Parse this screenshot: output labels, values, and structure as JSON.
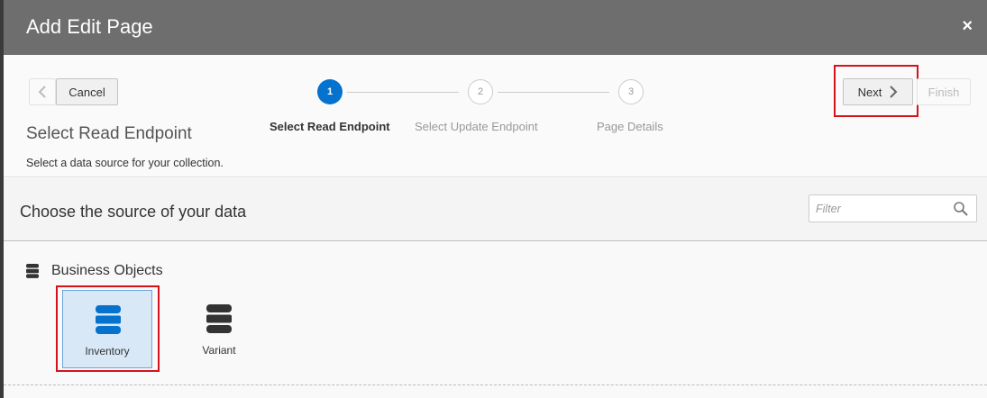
{
  "dialog": {
    "title": "Add Edit Page",
    "close_glyph": "×"
  },
  "nav": {
    "cancel_label": "Cancel",
    "next_label": "Next",
    "finish_label": "Finish"
  },
  "step": {
    "title": "Select Read Endpoint",
    "description": "Select a data source for your collection."
  },
  "train": {
    "stops": [
      {
        "number": "1",
        "label": "Select Read Endpoint",
        "state": "active"
      },
      {
        "number": "2",
        "label": "Select Update Endpoint",
        "state": "inactive"
      },
      {
        "number": "3",
        "label": "Page Details",
        "state": "inactive"
      }
    ]
  },
  "source": {
    "title": "Choose the source of your data",
    "filter_placeholder": "Filter"
  },
  "business_objects": {
    "heading": "Business Objects",
    "items": [
      {
        "label": "Inventory",
        "selected": true,
        "icon": "database-icon",
        "color": "#0572ce"
      },
      {
        "label": "Variant",
        "selected": false,
        "icon": "database-icon",
        "color": "#333333"
      }
    ]
  }
}
